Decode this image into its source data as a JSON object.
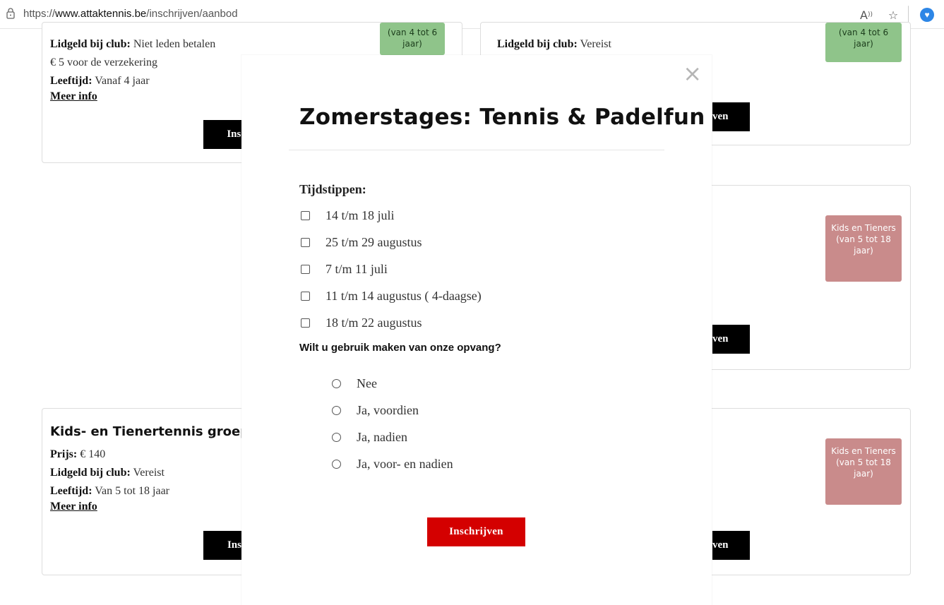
{
  "browser": {
    "url_scheme": "https://",
    "url_host": "www.attaktennis.be",
    "url_path": "/inschrijven/aanbod",
    "read_aloud_icon": "read-aloud-icon",
    "favorite_icon": "star-icon",
    "extension_icon": "shield-icon"
  },
  "background": {
    "card_tl": {
      "lidgeld_label": "Lidgeld bij club:",
      "lidgeld_value": " Niet leden betalen",
      "insurance": "€ 5 voor de verzekering",
      "age_label": "Leeftijd:",
      "age_value": " Vanaf 4 jaar",
      "more": "Meer info",
      "button": "Insc",
      "badge": "(van 4 tot 6 jaar)"
    },
    "card_tr": {
      "lidgeld_label": "Lidgeld bij club:",
      "lidgeld_value": " Vereist",
      "badge": "(van 4 tot 6 jaar)",
      "button": "ven"
    },
    "card_mr": {
      "badge": "Kids en Tieners (van 5 tot 18 jaar)",
      "button": "ven"
    },
    "card_bl": {
      "title": "Kids- en Tienertennis groepsles",
      "price_label": "Prijs:",
      "price_value": " € 140",
      "lidgeld_label": "Lidgeld bij club:",
      "lidgeld_value": " Vereist",
      "age_label": "Leeftijd:",
      "age_value": " Van 5 tot 18 jaar",
      "more": "Meer info",
      "button": "Ins"
    },
    "card_br": {
      "badge": "Kids en Tieners (van 5 tot 18 jaar)",
      "button": "ven"
    }
  },
  "modal": {
    "close": "×",
    "title": "Zomerstages: Tennis & Padelfun",
    "times_label": "Tijdstippen:",
    "times": [
      "14 t/m 18 juli",
      "25 t/m 29 augustus",
      "7 t/m 11 juli",
      "11 t/m 14 augustus ( 4-daagse)",
      "18 t/m 22 augustus"
    ],
    "question": "Wilt u gebruik maken van onze opvang?",
    "options": [
      "Nee",
      "Ja, voordien",
      "Ja, nadien",
      "Ja, voor- en nadien"
    ],
    "submit": "Inschrijven"
  }
}
